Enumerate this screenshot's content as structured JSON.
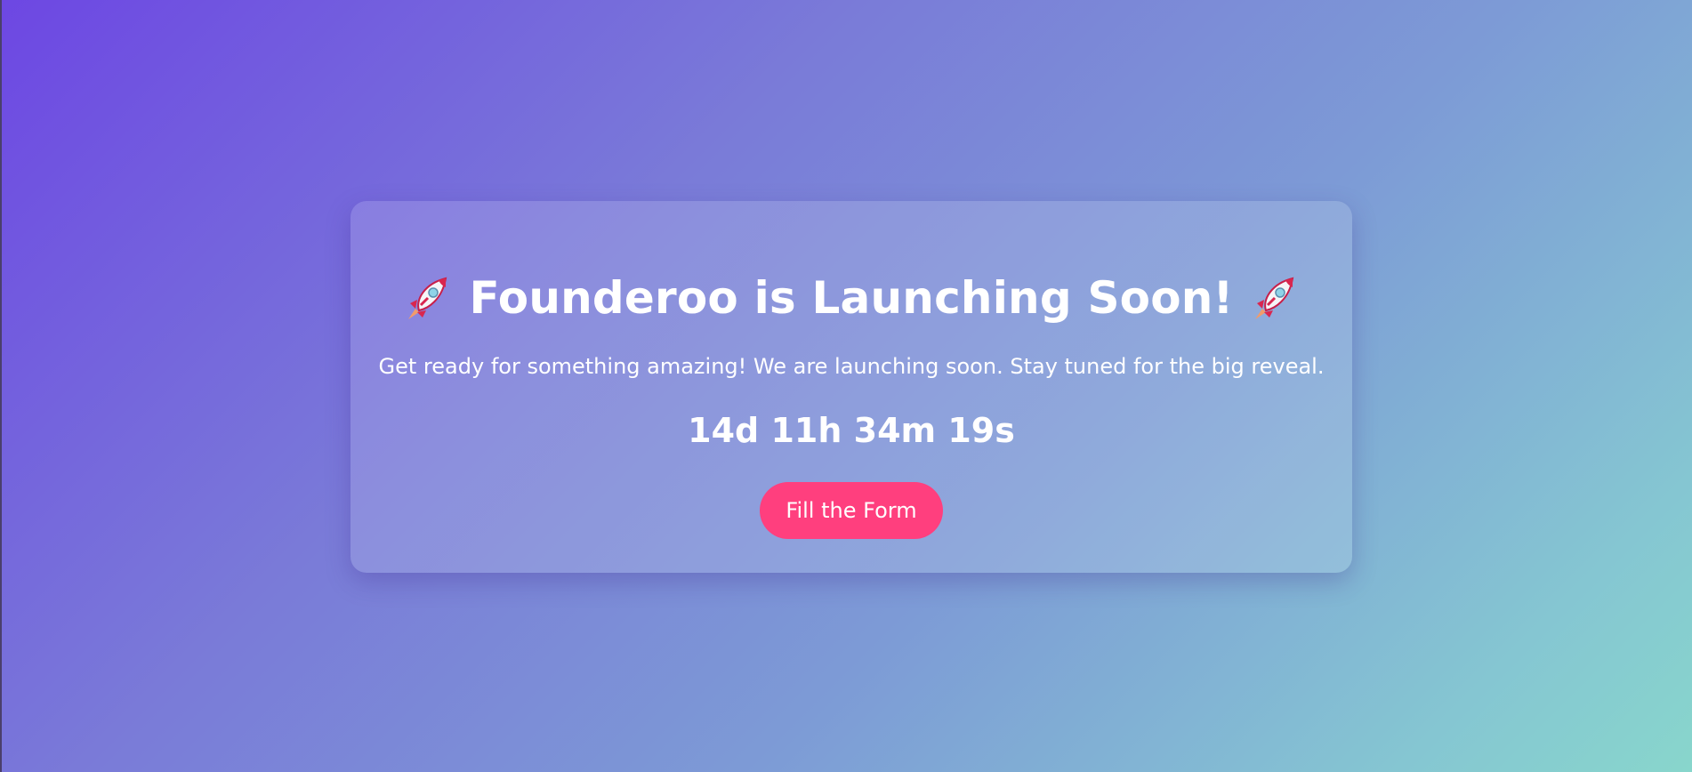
{
  "hero": {
    "title": "Founderoo is Launching Soon!",
    "leading_icon": "rocket-icon",
    "trailing_icon": "rocket-icon",
    "subtitle": "Get ready for something amazing! We are launching soon. Stay tuned for the big reveal.",
    "countdown": "14d 11h 34m 19s",
    "cta_label": "Fill the Form"
  },
  "colors": {
    "gradient_start": "#6d47e3",
    "gradient_end": "#88d6cc",
    "cta_background": "#ff3f7e",
    "text": "#ffffff"
  }
}
